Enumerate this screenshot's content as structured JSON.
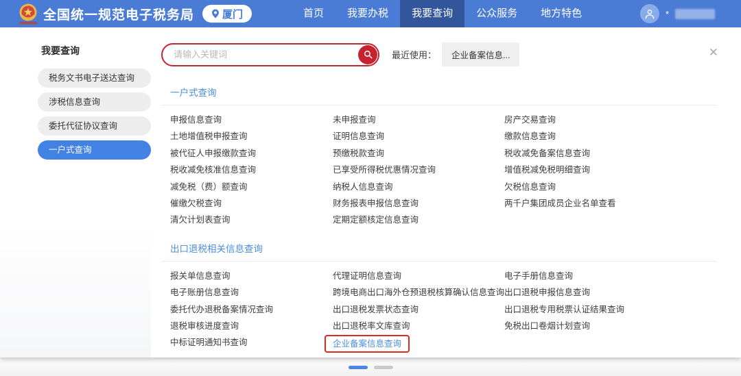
{
  "header": {
    "title": "全国统一规范电子税务局",
    "location": "厦门",
    "nav": [
      "首页",
      "我要办税",
      "我要查询",
      "公众服务",
      "地方特色"
    ],
    "active_nav": 2,
    "user_prefix": "*"
  },
  "sidebar": {
    "title": "我要查询",
    "items": [
      "税务文书电子送达查询",
      "涉税信息查询",
      "委托代征协议查询",
      "一户式查询"
    ],
    "active_item": 3
  },
  "search": {
    "placeholder": "请输入关键词",
    "recent_label": "最近使用：",
    "recent_item": "企业备案信息..."
  },
  "sections": [
    {
      "title": "一户式查询",
      "columns": [
        [
          "申报信息查询",
          "土地增值税申报查询",
          "被代征人申报缴款查询",
          "税收减免核准信息查询",
          "减免税（费）额查询",
          "催缴欠税查询",
          "清欠计划表查询"
        ],
        [
          "未申报查询",
          "证明信息查询",
          "预缴税款查询",
          "已享受所得税优惠情况查询",
          "纳税人信息查询",
          "财务报表申报信息查询",
          "定期定额核定信息查询"
        ],
        [
          "房产交易查询",
          "缴款信息查询",
          "税收减免备案信息查询",
          "增值税减免税明细查询",
          "欠税信息查询",
          "两千户集团成员企业名单查看"
        ]
      ]
    },
    {
      "title": "出口退税相关信息查询",
      "columns": [
        [
          "报关单信息查询",
          "电子账册信息查询",
          "委托代办退税备案情况查询",
          "退税审核进度查询",
          "中标证明通知书查询"
        ],
        [
          "代理证明信息查询",
          "跨境电商出口海外仓预退税核算确认信息查询",
          "出口退税发票状态查询",
          "出口退税率文库查询",
          {
            "label": "企业备案信息查询",
            "highlight": true
          }
        ],
        [
          "电子手册信息查询",
          "出口退税申报信息查询",
          "出口退税专用税票认证结果查询",
          "免税出口卷烟计划查询"
        ]
      ]
    }
  ],
  "pagination": {
    "count": 2,
    "active": 0
  },
  "icons": {
    "close": "✕",
    "logo": "national-emblem",
    "location": "location-pin",
    "search": "magnifier",
    "avatar": "person"
  },
  "colors": {
    "header_blue": "#4a7cd6",
    "nav_active_blue": "#31569c",
    "sidebar_active_blue": "#4182e4",
    "section_title_blue": "#4a90dc",
    "search_red": "#c5232e",
    "highlight_box_red": "#e0291e",
    "highlight_link_blue": "#4a90e2",
    "pagination_active_blue": "#4a86e8"
  }
}
